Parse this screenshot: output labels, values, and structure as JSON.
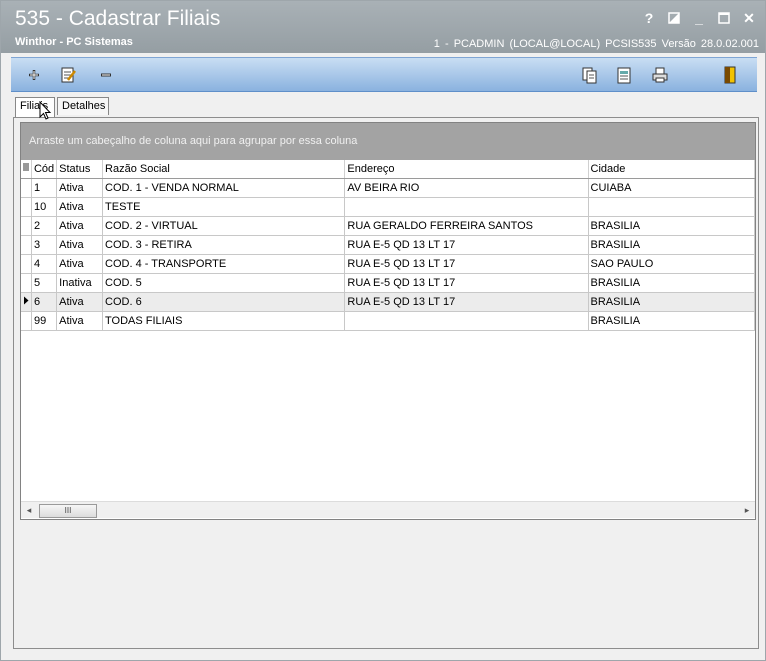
{
  "window": {
    "title": "535 - Cadastrar Filiais",
    "subtitle": "Winthor - PC Sistemas",
    "status": "1 - PCADMIN (LOCAL@LOCAL)   PCSIS535  Versão  28.0.02.001",
    "help_glyph": "?",
    "minimize_glyph": "_",
    "close_glyph": "✕"
  },
  "tabs": [
    {
      "label": "Filiais",
      "active": true
    },
    {
      "label": "Detalhes",
      "active": false
    }
  ],
  "grid": {
    "group_hint": "Arraste um cabeçalho de coluna aqui para agrupar por essa coluna",
    "columns": [
      "Cód",
      "Status",
      "Razão Social",
      "Endereço",
      "Cidade"
    ],
    "rows": [
      {
        "code": "1",
        "status": "Ativa",
        "razao": "COD. 1 - VENDA NORMAL",
        "endereco": "AV BEIRA RIO",
        "cidade": "CUIABA"
      },
      {
        "code": "10",
        "status": "Ativa",
        "razao": "TESTE",
        "endereco": "",
        "cidade": ""
      },
      {
        "code": "2",
        "status": "Ativa",
        "razao": "COD. 2 - VIRTUAL",
        "endereco": "RUA GERALDO FERREIRA SANTOS",
        "cidade": "BRASILIA"
      },
      {
        "code": "3",
        "status": "Ativa",
        "razao": "COD. 3 - RETIRA",
        "endereco": "RUA E-5 QD 13 LT 17",
        "cidade": "BRASILIA"
      },
      {
        "code": "4",
        "status": "Ativa",
        "razao": "COD. 4 - TRANSPORTE",
        "endereco": "RUA E-5 QD 13 LT 17",
        "cidade": "SAO PAULO"
      },
      {
        "code": "5",
        "status": "Inativa",
        "razao": "COD. 5",
        "endereco": "RUA E-5 QD 13 LT 17",
        "cidade": "BRASILIA"
      },
      {
        "code": "6",
        "status": "Ativa",
        "razao": "COD. 6",
        "endereco": "RUA E-5 QD 13 LT 17",
        "cidade": "BRASILIA"
      },
      {
        "code": "99",
        "status": "Ativa",
        "razao": "TODAS FILIAIS",
        "endereco": "",
        "cidade": "BRASILIA"
      }
    ],
    "selected_row_code": "6",
    "scroll": {
      "left": "◂",
      "right": "▸",
      "thumb": "III"
    }
  },
  "colors": {
    "toolbar_blue": "#8ab2df",
    "titlebar": "#a1a9ae",
    "groupbar": "#a3a3a3"
  }
}
